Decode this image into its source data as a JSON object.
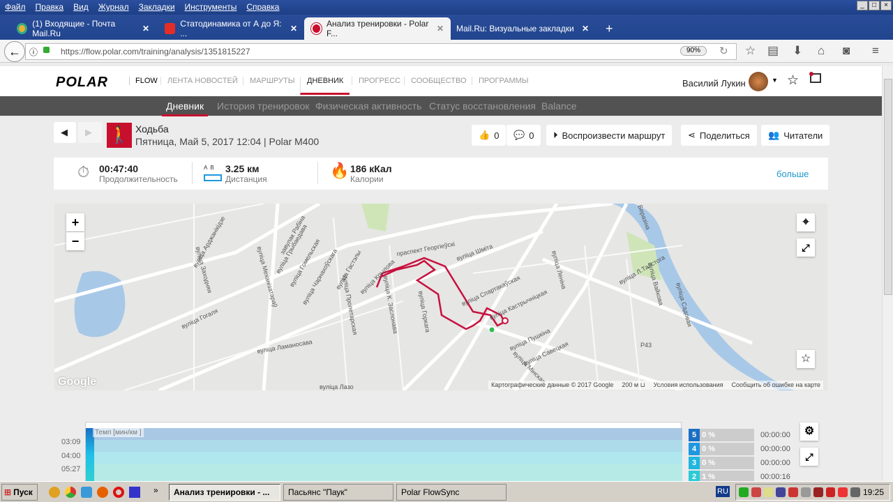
{
  "browser": {
    "menu": [
      "Файл",
      "Правка",
      "Вид",
      "Журнал",
      "Закладки",
      "Инструменты",
      "Справка"
    ],
    "tabs": [
      {
        "title": "(1) Входящие - Почта Mail.Ru"
      },
      {
        "title": "Статодинамика от А до Я: ..."
      },
      {
        "title": "Анализ тренировки - Polar F..."
      },
      {
        "title": "Mail.Ru: Визуальные закладки"
      }
    ],
    "url": "https://flow.polar.com/training/analysis/1351815227",
    "zoom": "90%"
  },
  "header": {
    "logo": "POLAR",
    "flow": "FLOW",
    "nav": [
      "ЛЕНТА НОВОСТЕЙ",
      "МАРШРУТЫ",
      "ДНЕВНИК",
      "ПРОГРЕСС",
      "СООБЩЕСТВО",
      "ПРОГРАММЫ"
    ],
    "user": "Василий Лукин"
  },
  "subnav": [
    "Дневник",
    "История тренировок",
    "Физическая активность",
    "Статус восстановления",
    "Balance"
  ],
  "activity": {
    "sport": "Ходьба",
    "details": "Пятница, Май 5, 2017 12:04 | Polar M400",
    "likes": "0",
    "comments": "0",
    "replay": "Воспроизвести маршрут",
    "share": "Поделиться",
    "readers": "Читатели"
  },
  "stats": {
    "duration": "00:47:40",
    "duration_label": "Продолжительность",
    "distance": "3.25 км",
    "distance_label": "Дистанция",
    "distance_ab": "A  B",
    "calories": "186 кКал",
    "calories_label": "Калории",
    "more": "больше"
  },
  "map": {
    "zoom_in": "+",
    "zoom_out": "−",
    "google": "Google",
    "streets": [
      "праспект Георгіеўскі",
      "вуліца Арджанікідзе",
      "завулак Рабіна",
      "вуліца Грыбаедава",
      "вуліца Гомельская",
      "вуліца Чарнахоўскага",
      "вуліца Гастэлы",
      "вуліца Крылова",
      "вуліца Шміта",
      "вуліца Спартакаўская",
      "вуліца Кастрычніцкая",
      "вуліца Леніна",
      "вуліца Л.Талстога",
      "вуліца Вайкова",
      "вуліца Садовая",
      "вуліца Пушкіна",
      "вуліца Савецкая",
      "вуліца Мінская",
      "вуліца Гогаля",
      "вуліца Ламаносава",
      "вуліца Механізатараў",
      "вуліца Заходняя",
      "вуліца Пролетарская",
      "вуліца К. Заслонава",
      "вуліца Горкага",
      "р. Беразіна",
      "вуліца Лазо",
      "P43"
    ],
    "attribution": "Картографические данные © 2017 Google",
    "scale": "200 м",
    "terms": "Условия использования",
    "report": "Сообщить об ошибке на карте"
  },
  "chart": {
    "legend": "Темп [мин/км ]",
    "yticks": [
      "03:09",
      "04:00",
      "05:27"
    ]
  },
  "zones": [
    {
      "n": "5",
      "pct": "0 %",
      "time": "00:00:00",
      "color": "#1a6fc4"
    },
    {
      "n": "4",
      "pct": "0 %",
      "time": "00:00:00",
      "color": "#1e98e0"
    },
    {
      "n": "3",
      "pct": "0 %",
      "time": "00:00:00",
      "color": "#20b6e0"
    },
    {
      "n": "2",
      "pct": "1 %",
      "time": "00:00:16",
      "color": "#2ccad6"
    }
  ],
  "taskbar": {
    "start": "Пуск",
    "tasks": [
      "Анализ тренировки - ...",
      "Пасьянс \"Паук\"",
      "Polar FlowSync"
    ],
    "lang": "RU",
    "clock": "19:25"
  }
}
